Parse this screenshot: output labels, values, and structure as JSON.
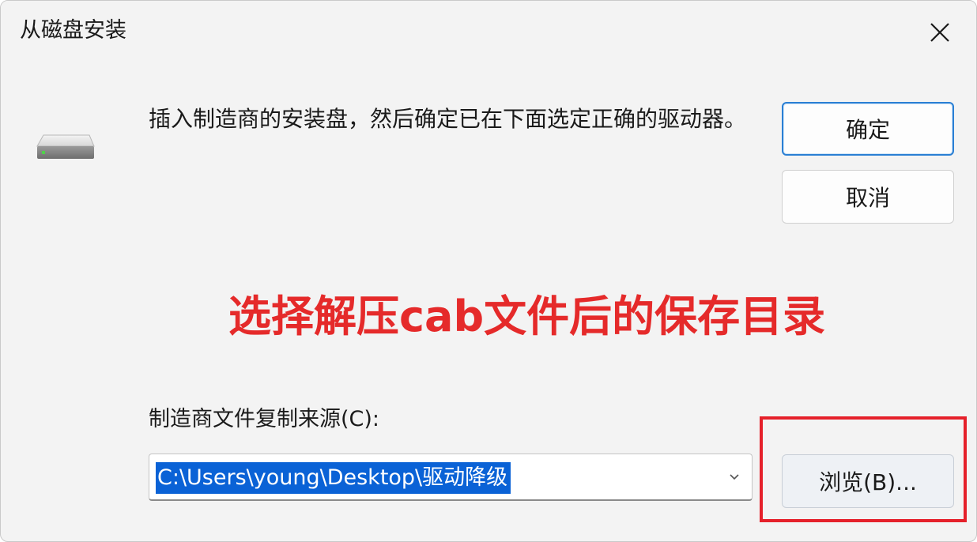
{
  "dialog": {
    "title": "从磁盘安装",
    "instruction": "插入制造商的安装盘，然后确定已在下面选定正确的驱动器。",
    "buttons": {
      "ok": "确定",
      "cancel": "取消",
      "browse": "浏览(B)..."
    },
    "source_label": "制造商文件复制来源(C):",
    "source_path": "C:\\Users\\young\\Desktop\\驱动降级"
  },
  "annotation": {
    "text": "选择解压cab文件后的保存目录",
    "color": "#e52a2a"
  },
  "colors": {
    "accent": "#2a7fd4",
    "selection": "#0a62d6",
    "highlight_box": "#e5202a"
  },
  "icons": {
    "close": "close-icon",
    "drive": "disk-drive-icon",
    "dropdown": "chevron-down-icon"
  }
}
